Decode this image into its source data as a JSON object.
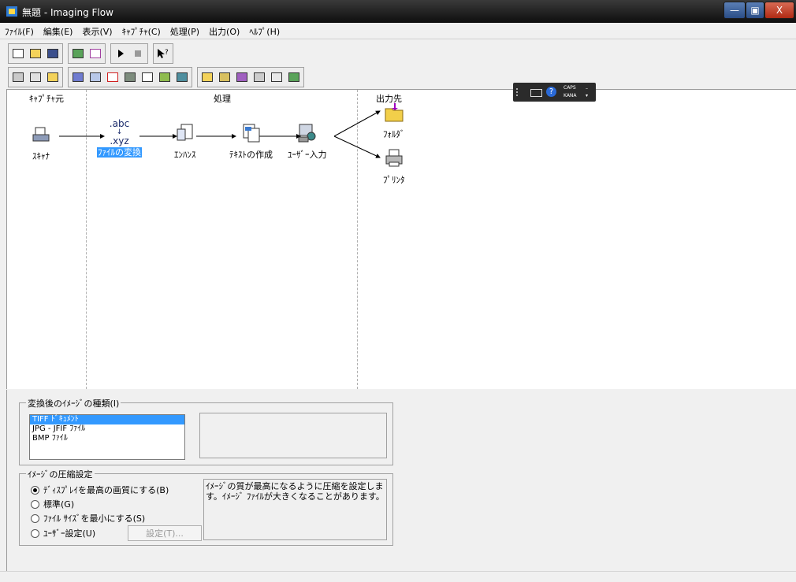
{
  "window": {
    "title": "無題 - Imaging Flow",
    "controls": [
      "—",
      "▣",
      "X"
    ]
  },
  "menu": [
    "ﾌｧｲﾙ(F)",
    "編集(E)",
    "表示(V)",
    "ｷｬﾌﾟﾁｬ(C)",
    "処理(P)",
    "出力(O)",
    "ﾍﾙﾌﾟ(H)"
  ],
  "flow": {
    "columns": [
      "ｷｬﾌﾟﾁｬ元",
      "処理",
      "出力先"
    ],
    "nodes": {
      "scanner": "ｽｷｬﾅ",
      "convert": "ﾌｧｲﾙの変換",
      "convert_icon_top": ".abc",
      "convert_icon_bottom": ".xyz",
      "enhance": "ｴﾝﾊﾝｽ",
      "text": "ﾃｷｽﾄの作成",
      "user_input": "ﾕｰｻﾞｰ入力",
      "folder": "ﾌｫﾙﾀﾞ",
      "printer": "ﾌﾟﾘﾝﾀ"
    }
  },
  "langbar": {
    "caps": "CAPS",
    "kana": "KANA"
  },
  "image_type": {
    "label": "変換後のｲﾒｰｼﾞの種類(I)",
    "options": [
      "TIFF ﾄﾞｷｭﾒﾝﾄ",
      "JPG - JFIF ﾌｧｲﾙ",
      "BMP ﾌｧｲﾙ"
    ],
    "selected": "TIFF ﾄﾞｷｭﾒﾝﾄ"
  },
  "compression": {
    "label": "ｲﾒｰｼﾞの圧縮設定",
    "options": [
      "ﾃﾞｨｽﾌﾟﾚｲを最高の画質にする(B)",
      "標準(G)",
      "ﾌｧｲﾙ ｻｲｽﾞを最小にする(S)",
      "ﾕｰｻﾞｰ設定(U)"
    ],
    "selected": "ﾃﾞｨｽﾌﾟﾚｲを最高の画質にする(B)",
    "settings_button": "設定(T)...",
    "description": "ｲﾒｰｼﾞの質が最高になるように圧縮を設定します。ｲﾒｰｼﾞ ﾌｧｲﾙが大きくなることがあります。"
  },
  "colors": {
    "selection": "#3399ff",
    "titlebar": "#111111"
  }
}
